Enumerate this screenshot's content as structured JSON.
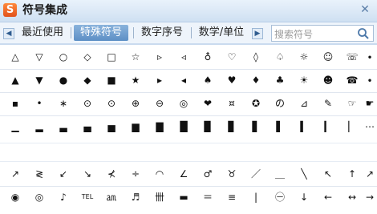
{
  "window": {
    "title": "符号集成",
    "logo_char": "S",
    "close_glyph": "✕"
  },
  "tabs": {
    "prev_glyph": "◀",
    "next_glyph": "▶",
    "items": [
      {
        "label": "最近使用"
      },
      {
        "label": "特殊符号",
        "active": true
      },
      {
        "label": "数字序号"
      },
      {
        "label": "数学/单位"
      }
    ]
  },
  "search": {
    "placeholder": "搜索符号",
    "icon": "search-icon"
  },
  "grid_top": [
    [
      "△",
      "▽",
      "○",
      "◇",
      "□",
      "☆",
      "▹",
      "◃",
      "♁",
      "♡",
      "◊",
      "♤",
      "☼",
      "☺",
      "☏",
      "∙"
    ],
    [
      "▲",
      "▼",
      "●",
      "◆",
      "■",
      "★",
      "▸",
      "◂",
      "♠",
      "♥",
      "♦",
      "♣",
      "☀",
      "☻",
      "☎",
      "∙"
    ],
    [
      "▪",
      "•",
      "∗",
      "⊙",
      "⊙",
      "⊕",
      "⊖",
      "◎",
      "❤",
      "¤",
      "✪",
      "の",
      "⊿",
      "✎",
      "☞",
      "☛"
    ],
    [
      "▁",
      "▂",
      "▃",
      "▄",
      "▅",
      "▆",
      "▇",
      "█",
      "▉",
      "▊",
      "▋",
      "▌",
      "▍",
      "▎",
      "▏",
      "⋯"
    ]
  ],
  "grid_bottom": [
    [
      "↗",
      "≷",
      "↙",
      "↘",
      "⊀",
      "÷",
      "◠",
      "∠",
      "♂",
      "♉",
      "／",
      "＿",
      "╲",
      "↖",
      "↑",
      "↗"
    ],
    [
      "◉",
      "◎",
      "♪",
      "TEL",
      "㏂",
      "♬",
      "卌",
      "▬",
      "＝",
      "≡",
      "|",
      "㊀",
      "↓",
      "←",
      "↔",
      "→"
    ]
  ]
}
